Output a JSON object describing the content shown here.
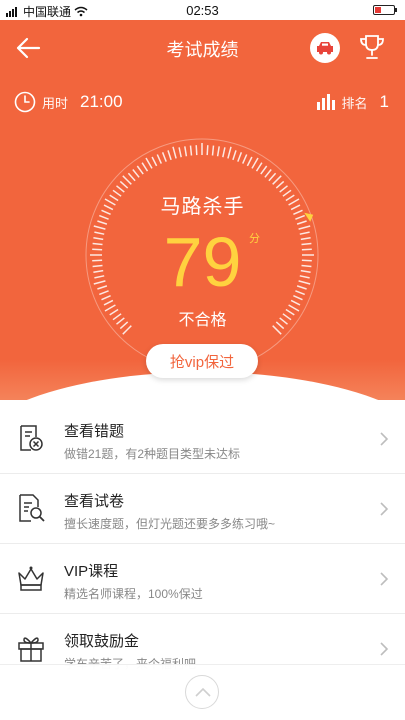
{
  "status": {
    "carrier": "中国联通",
    "time": "02:53"
  },
  "nav": {
    "title": "考试成绩"
  },
  "meta": {
    "time_label": "用时",
    "time_value": "21:00",
    "rank_label": "排名",
    "rank_value": "1"
  },
  "score": {
    "title": "马路杀手",
    "value": "79",
    "unit": "分",
    "result": "不合格"
  },
  "vip_button": "抢vip保过",
  "items": [
    {
      "title": "查看错题",
      "desc": "做错21题，有2种题目类型未达标",
      "icon": "wrong-questions-icon"
    },
    {
      "title": "查看试卷",
      "desc": "擅长速度题，但灯光题还要多多练习哦~",
      "icon": "exam-paper-icon"
    },
    {
      "title": "VIP课程",
      "desc": "精选名师课程，100%保过",
      "icon": "crown-icon"
    },
    {
      "title": "领取鼓励金",
      "desc": "学车辛苦了，来个福利吧",
      "icon": "gift-icon"
    }
  ],
  "colors": {
    "primary": "#f2653d",
    "score": "#ffd23f"
  }
}
